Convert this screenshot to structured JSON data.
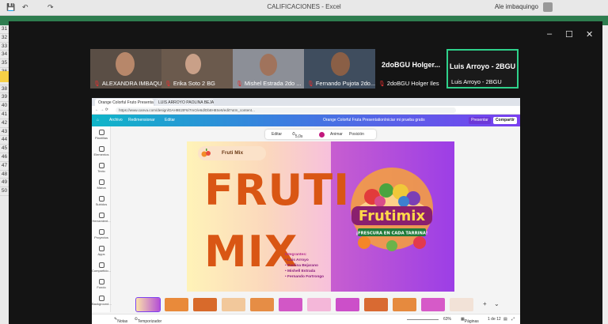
{
  "excel": {
    "title": "CALIFICACIONES  -  Excel",
    "user": "Ale imbaquingo",
    "row_numbers": [
      "31",
      "32",
      "33",
      "34",
      "35",
      "36",
      "37",
      "38",
      "39",
      "40",
      "41",
      "42",
      "43",
      "44",
      "45",
      "46",
      "47",
      "48",
      "49",
      "50"
    ]
  },
  "modal": {
    "minimize": "–",
    "maximize": "☐",
    "close": "✕"
  },
  "participants": [
    {
      "name": "ALEXANDRA IMBAQU...",
      "muted": true
    },
    {
      "name": "Erika Soto 2 BG",
      "muted": true
    },
    {
      "name": "Mishel Estrada 2do ...",
      "muted": true
    },
    {
      "name": "Fernando Pujota 2do...",
      "muted": true
    },
    {
      "name": "2doBGU Holger Iles",
      "big": "2doBGU  Holger...",
      "muted": true
    },
    {
      "name": "Luis Arroyo - 2BGU",
      "big": "Luis Arroyo - 2BGU",
      "active": true
    }
  ],
  "browser": {
    "tab1": "Orange Colorful Fruto Presentatio...",
    "tab2": "LUIS ARROYO PAOLINA BEJARANO...",
    "url": "https://www.canva.com/design/DAH9E2tF6/7mO/e6d/Db8H8Se6/edit?utm_content..."
  },
  "canva": {
    "menu": [
      "Archivo",
      "Redimensionar",
      "Editar"
    ],
    "doc_title": "Orange Colorful Fruta Presentation",
    "trial": "Iniciar mi prueba gratis",
    "present": "Presentar",
    "share": "Compartir",
    "sidebar": [
      "Plantillas",
      "Elementos",
      "Texto",
      "Marca",
      "Subidos",
      "Herramient...",
      "Proyectos",
      "Apps",
      "Compartido...",
      "Fondo",
      "Background..."
    ],
    "edit_bar": {
      "edit": "Editar",
      "duration": "5,0s",
      "animate": "Animar",
      "position": "Posición"
    },
    "status": {
      "notes": "Notas",
      "timer": "Temporizador",
      "zoom": "63%",
      "pages": "Páginas",
      "page_count": "1 de 12"
    }
  },
  "slide": {
    "badge": "Fruti Mix",
    "word1": "FRUTI",
    "word2": "MIX",
    "members_heading": "Integrantes:",
    "members": [
      "Luis Arroyo",
      "Paolina Bejarano",
      "Mishell Estrada",
      "Fernando Fortrongo"
    ],
    "logo_brand": "Frutimix",
    "logo_tagline": "¡FRESCURA EN CADA TARRINA!"
  },
  "colors": {
    "title_orange": "#d95614",
    "active_speaker": "#2fd18b",
    "canva_purple": "#7a3ff0"
  }
}
